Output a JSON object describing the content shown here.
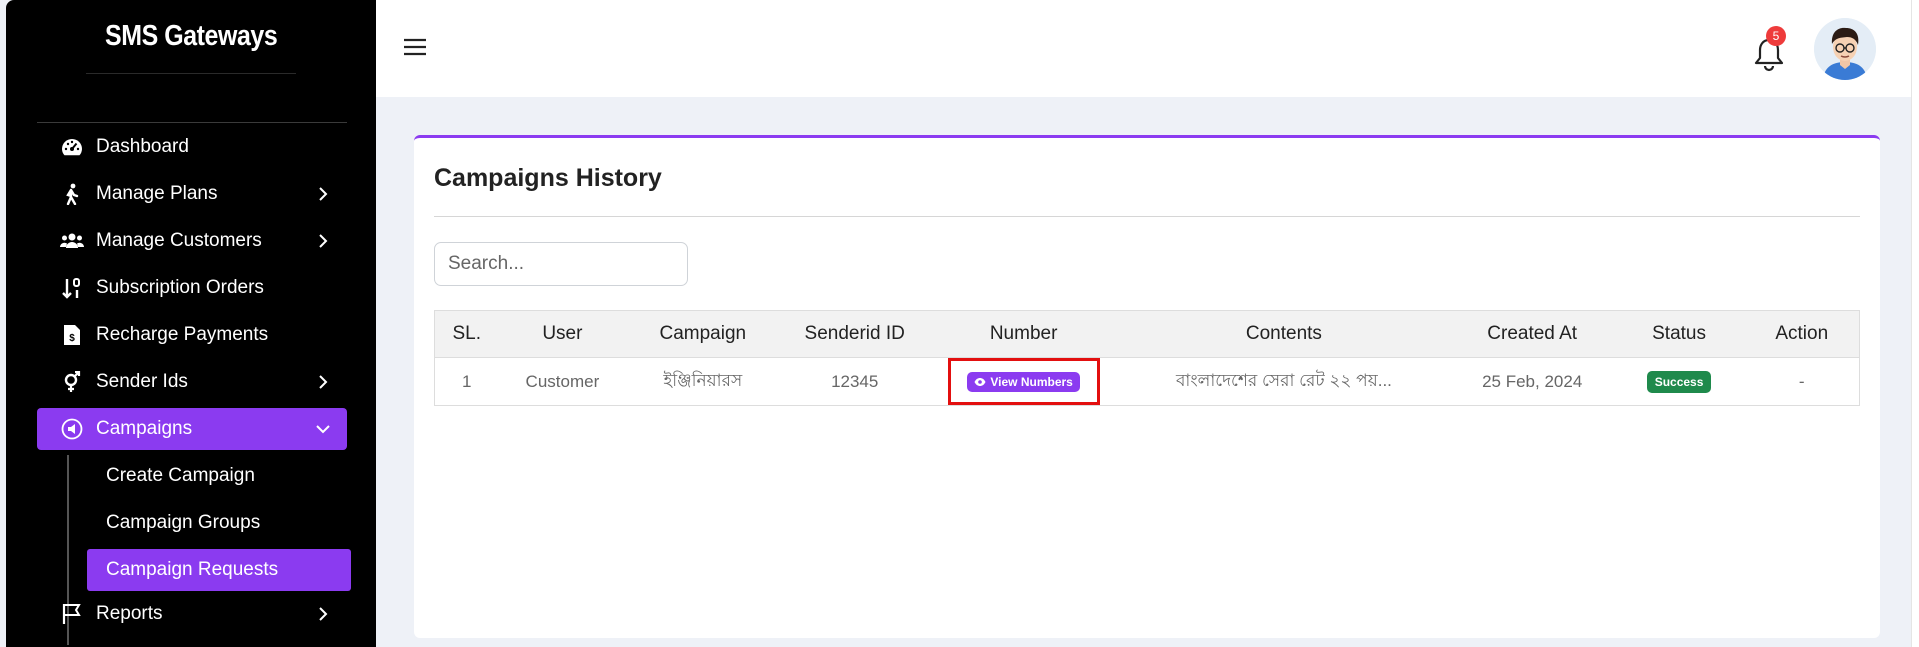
{
  "brand": {
    "name": "SMS Gateways"
  },
  "sidebar": {
    "items": [
      {
        "label": "Dashboard",
        "icon": "dashboard-icon"
      },
      {
        "label": "Manage Plans",
        "icon": "walking-icon"
      },
      {
        "label": "Manage Customers",
        "icon": "users-icon"
      },
      {
        "label": "Subscription Orders",
        "icon": "sort-icon"
      },
      {
        "label": "Recharge Payments",
        "icon": "invoice-icon"
      },
      {
        "label": "Sender Ids",
        "icon": "gender-icon"
      },
      {
        "label": "Campaigns",
        "icon": "campaign-icon"
      },
      {
        "label": "Reports",
        "icon": "flag-icon"
      }
    ],
    "campaigns_submenu": [
      {
        "label": "Create Campaign"
      },
      {
        "label": "Campaign Groups"
      },
      {
        "label": "Campaign Requests"
      }
    ]
  },
  "header": {
    "notification_count": "5"
  },
  "main": {
    "title": "Campaigns History",
    "search": {
      "placeholder": "Search...",
      "value": ""
    },
    "table": {
      "columns": [
        "SL.",
        "User",
        "Campaign",
        "Senderid ID",
        "Number",
        "Contents",
        "Created At",
        "Status",
        "Action"
      ],
      "rows": [
        {
          "sl": "1",
          "user": "Customer",
          "campaign": "ইঞ্জিনিয়ারস",
          "senderid": "12345",
          "number_button": "View Numbers",
          "contents": "বাংলাদেশের সেরা রেট ২২ পয়...",
          "created_at": "25 Feb, 2024",
          "status": "Success",
          "action": "-"
        }
      ]
    }
  },
  "colors": {
    "accent": "#8b3bf0",
    "success": "#1f8a4c",
    "highlight": "#e30f0f",
    "sidebar_bg": "#000000"
  }
}
